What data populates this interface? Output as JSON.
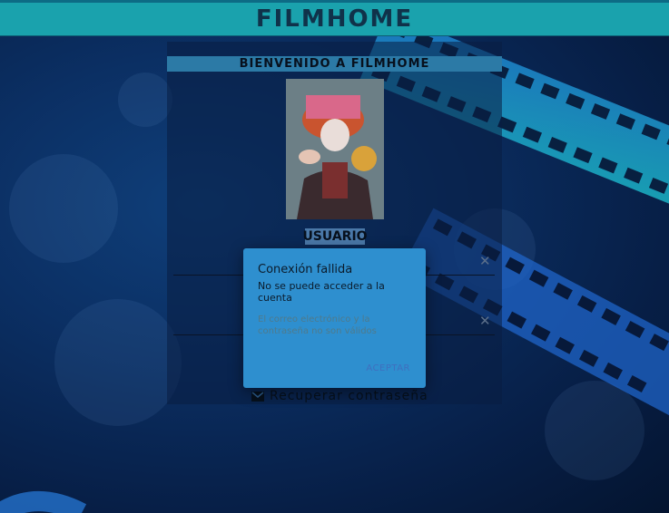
{
  "app": {
    "brand": "FILMHOME"
  },
  "login": {
    "title": "BIENVENIDO A FILMHOME",
    "user_label": "USUARIO",
    "recover_label": "Recuperar contraseña",
    "clear_icon": "close-icon",
    "mail_icon": "mail-icon"
  },
  "dialog": {
    "title": "Conexión fallida",
    "subtitle": "No se puede acceder a la cuenta",
    "message": "El correo electrónico y la contraseña no son válidos",
    "button_label": "ACEPTAR"
  },
  "colors": {
    "topbar": "#1aa2ad",
    "dialog": "#2e8fcf",
    "brand_text": "#10324a"
  }
}
